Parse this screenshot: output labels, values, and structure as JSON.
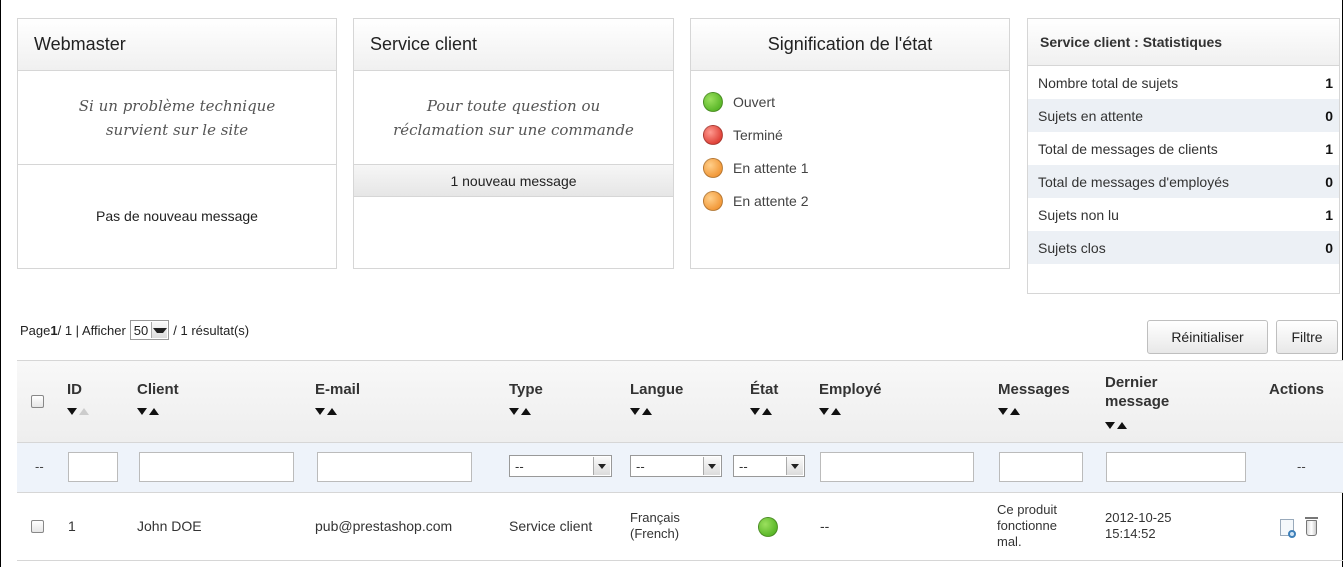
{
  "panels": {
    "webmaster": {
      "title": "Webmaster",
      "desc_l1": "Si un problème technique",
      "desc_l2": "survient sur le site",
      "message": "Pas de nouveau message"
    },
    "service": {
      "title": "Service client",
      "desc_l1": "Pour toute question ou",
      "desc_l2": "réclamation sur une commande",
      "message": "1 nouveau message"
    },
    "legend": {
      "title": "Signification de l'état",
      "items": [
        {
          "label": "Ouvert",
          "color": "#5cb82a"
        },
        {
          "label": "Terminé",
          "color": "#e0443a"
        },
        {
          "label": "En attente 1",
          "color": "#f29a3b"
        },
        {
          "label": "En attente 2",
          "color": "#f29a3b"
        }
      ]
    }
  },
  "stats": {
    "title": "Service client : Statistiques",
    "rows": [
      {
        "label": "Nombre total de sujets",
        "value": "1"
      },
      {
        "label": "Sujets en attente",
        "value": "0"
      },
      {
        "label": "Total de messages de clients",
        "value": "1"
      },
      {
        "label": "Total de messages d'employés",
        "value": "0"
      },
      {
        "label": "Sujets non lu",
        "value": "1"
      },
      {
        "label": "Sujets clos",
        "value": "0"
      }
    ]
  },
  "pagination": {
    "page_prefix": "Page ",
    "page_current": "1",
    "page_sep": " / 1 | Afficher",
    "per_page": "50",
    "results": "/ 1 résultat(s)"
  },
  "buttons": {
    "reset": "Réinitialiser",
    "filter": "Filtre"
  },
  "table": {
    "headers": {
      "id": "ID",
      "client": "Client",
      "email": "E-mail",
      "type": "Type",
      "langue": "Langue",
      "etat": "État",
      "employe": "Employé",
      "messages": "Messages",
      "dernier_l1": "Dernier",
      "dernier_l2": "message",
      "actions": "Actions"
    },
    "filters": {
      "dash": "--",
      "type_value": "--",
      "langue_value": "--",
      "etat_value": "--",
      "actions_dash": "--"
    },
    "rows": [
      {
        "id": "1",
        "client": "John DOE",
        "email": "pub@prestashop.com",
        "type": "Service client",
        "langue_l1": "Français",
        "langue_l2": "(French)",
        "state_color": "#5cb82a",
        "employe": "--",
        "msg_l1": "Ce produit",
        "msg_l2": "fonctionne",
        "msg_l3": "mal.",
        "date": "2012-10-25",
        "time": "15:14:52"
      }
    ]
  }
}
